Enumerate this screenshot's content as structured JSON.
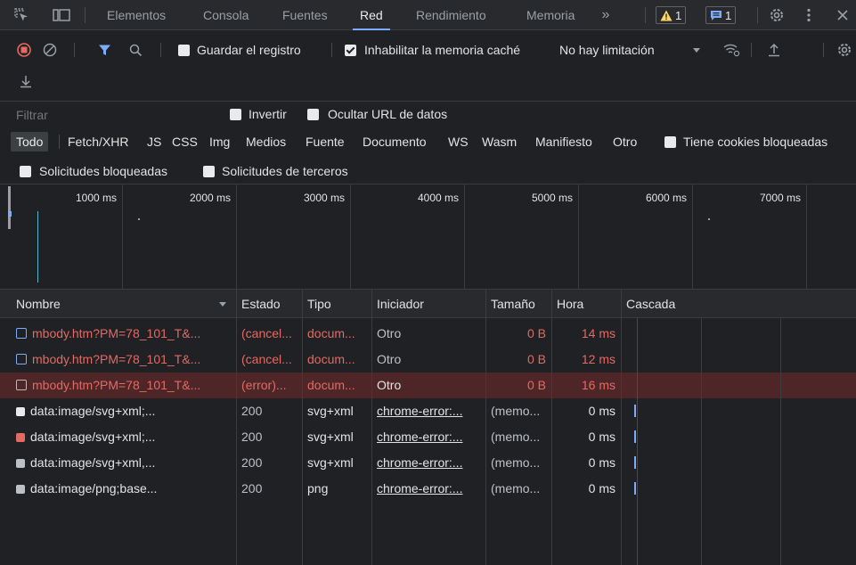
{
  "tabs": [
    {
      "label": "Elementos"
    },
    {
      "label": "Consola"
    },
    {
      "label": "Fuentes"
    },
    {
      "label": "Red"
    },
    {
      "label": "Rendimiento"
    },
    {
      "label": "Memoria"
    }
  ],
  "badges": {
    "warnings": "1",
    "messages": "1"
  },
  "toolbar": {
    "preserve_log": "Guardar el registro",
    "disable_cache": "Inhabilitar la memoria caché",
    "throttling": "No hay limitación"
  },
  "filter": {
    "placeholder": "Filtrar",
    "invert": "Invertir",
    "hide_data_urls": "Ocultar URL de datos",
    "types": [
      "Todo",
      "Fetch/XHR",
      "JS",
      "CSS",
      "Img",
      "Medios",
      "Fuente",
      "Documento",
      "WS",
      "Wasm",
      "Manifiesto",
      "Otro"
    ],
    "blocked_cookies": "Tiene cookies bloqueadas",
    "blocked_requests": "Solicitudes bloqueadas",
    "third_party": "Solicitudes de terceros"
  },
  "timeline": {
    "ticks": [
      "1000 ms",
      "2000 ms",
      "3000 ms",
      "4000 ms",
      "5000 ms",
      "6000 ms",
      "7000 ms"
    ]
  },
  "table": {
    "headers": {
      "name": "Nombre",
      "status": "Estado",
      "type": "Tipo",
      "initiator": "Iniciador",
      "size": "Tamaño",
      "time": "Hora",
      "waterfall": "Cascada"
    },
    "rows": [
      {
        "name": "mbody.htm?PM=78_101_T&...",
        "status": "(cancel...",
        "type": "docum...",
        "initiator": "Otro",
        "size": "0 B",
        "time": "14 ms"
      },
      {
        "name": "mbody.htm?PM=78_101_T&...",
        "status": "(cancel...",
        "type": "docum...",
        "initiator": "Otro",
        "size": "0 B",
        "time": "12 ms"
      },
      {
        "name": "mbody.htm?PM=78_101_T&...",
        "status": "(error)...",
        "type": "docum...",
        "initiator": "Otro",
        "size": "0 B",
        "time": "16 ms"
      },
      {
        "name": "data:image/svg+xml;...",
        "status": "200",
        "type": "svg+xml",
        "initiator": "chrome-error:...",
        "size": "(memo...",
        "time": "0 ms"
      },
      {
        "name": "data:image/svg+xml;...",
        "status": "200",
        "type": "svg+xml",
        "initiator": "chrome-error:...",
        "size": "(memo...",
        "time": "0 ms"
      },
      {
        "name": "data:image/svg+xml,...",
        "status": "200",
        "type": "svg+xml",
        "initiator": "chrome-error:...",
        "size": "(memo...",
        "time": "0 ms"
      },
      {
        "name": "data:image/png;base...",
        "status": "200",
        "type": "png",
        "initiator": "chrome-error:...",
        "size": "(memo...",
        "time": "0 ms"
      }
    ]
  },
  "colors": {
    "accent": "#7cacf8",
    "error": "#e46962",
    "record": "#e46962",
    "warning": "#fdd663",
    "message": "#7cacf8"
  }
}
